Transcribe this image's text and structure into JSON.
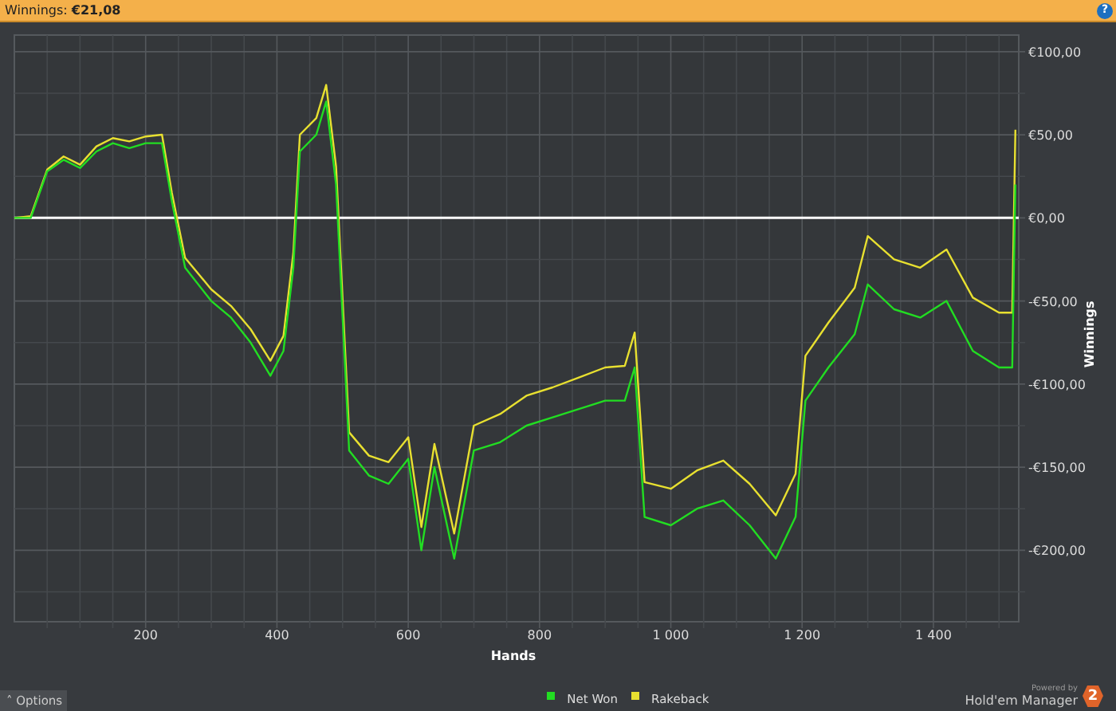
{
  "header": {
    "title": "Winnings: **€21,08**",
    "help": "?"
  },
  "chart": {
    "chart_data": {
      "type": "line",
      "grid": true,
      "xlabel": "Hands",
      "ylabel": "Winnings",
      "xlim": [
        0,
        1530
      ],
      "ylim": [
        -243,
        110
      ],
      "xticks": [
        {
          "value": 200,
          "label": "200"
        },
        {
          "value": 400,
          "label": "400"
        },
        {
          "value": 600,
          "label": "600"
        },
        {
          "value": 800,
          "label": "800"
        },
        {
          "value": 1000,
          "label": "1 000"
        },
        {
          "value": 1200,
          "label": "1 200"
        },
        {
          "value": 1400,
          "label": "1 400"
        }
      ],
      "yticks": [
        {
          "value": 100,
          "label": "€100,00"
        },
        {
          "value": 50,
          "label": "€50,00"
        },
        {
          "value": 0,
          "label": "€0,00"
        },
        {
          "value": -50,
          "label": "-€50,00"
        },
        {
          "value": -100,
          "label": "-€100,00"
        },
        {
          "value": -150,
          "label": "-€150,00"
        },
        {
          "value": -200,
          "label": "-€200,00"
        }
      ],
      "x": [
        0,
        25,
        50,
        75,
        100,
        125,
        150,
        175,
        200,
        225,
        240,
        260,
        300,
        330,
        360,
        390,
        410,
        425,
        435,
        460,
        475,
        490,
        500,
        510,
        540,
        570,
        600,
        620,
        640,
        670,
        700,
        740,
        780,
        820,
        860,
        900,
        930,
        945,
        960,
        1000,
        1040,
        1080,
        1120,
        1160,
        1190,
        1205,
        1240,
        1280,
        1300,
        1340,
        1380,
        1420,
        1460,
        1500,
        1520,
        1525
      ],
      "series": [
        {
          "name": "Net Won",
          "color": "#22dd22",
          "values": [
            0,
            0,
            28,
            35,
            30,
            40,
            45,
            42,
            45,
            45,
            10,
            -30,
            -50,
            -60,
            -75,
            -95,
            -80,
            -30,
            40,
            50,
            70,
            20,
            -60,
            -140,
            -155,
            -160,
            -145,
            -200,
            -150,
            -205,
            -140,
            -135,
            -125,
            -120,
            -115,
            -110,
            -110,
            -90,
            -180,
            -185,
            -175,
            -170,
            -185,
            -205,
            -180,
            -110,
            -90,
            -70,
            -40,
            -55,
            -60,
            -50,
            -80,
            -90,
            -90,
            20
          ]
        },
        {
          "name": "Rakeback",
          "color": "#e8e030",
          "values": [
            0,
            1,
            29,
            37,
            32,
            43,
            48,
            46,
            49,
            50,
            15,
            -24,
            -43,
            -53,
            -67,
            -86,
            -71,
            -21,
            50,
            60,
            80,
            31,
            -49,
            -129,
            -143,
            -147,
            -132,
            -186,
            -136,
            -190,
            -125,
            -118,
            -107,
            -102,
            -96,
            -90,
            -89,
            -69,
            -159,
            -163,
            -152,
            -146,
            -160,
            -179,
            -154,
            -83,
            -63,
            -42,
            -11,
            -25,
            -30,
            -19,
            -48,
            -57,
            -57,
            53
          ]
        }
      ]
    }
  },
  "footer": {
    "options": "Options",
    "caret": "˄",
    "powered_by": "Powered by",
    "brand": "Hold'em Manager",
    "brand_logo": "2"
  }
}
